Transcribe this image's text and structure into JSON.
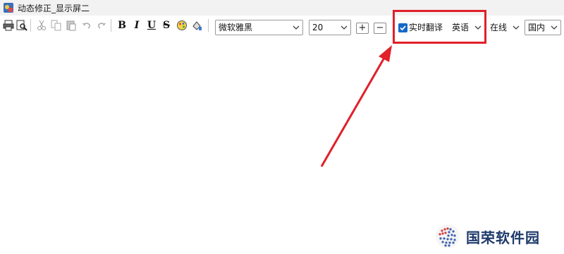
{
  "window": {
    "title": "动态修正_显示屏二"
  },
  "toolbar": {
    "icons": [
      {
        "name": "print-icon"
      },
      {
        "name": "print-preview-icon"
      },
      {
        "name": "cut-icon"
      },
      {
        "name": "copy-icon"
      },
      {
        "name": "paste-icon"
      },
      {
        "name": "undo-icon"
      },
      {
        "name": "redo-icon"
      },
      {
        "name": "bold-icon",
        "label": "B"
      },
      {
        "name": "italic-icon",
        "label": "I"
      },
      {
        "name": "underline-icon",
        "label": "U"
      },
      {
        "name": "strikethrough-icon",
        "label": "S"
      },
      {
        "name": "color-icon"
      },
      {
        "name": "fill-color-icon"
      }
    ],
    "font_family": "微软雅黑",
    "font_size": "20",
    "increase_label": "+",
    "decrease_label": "−",
    "realtime_translate": {
      "checked": true,
      "label": "实时翻译"
    },
    "language": "英语",
    "mode": "在线",
    "region": "国内"
  },
  "annotation": {
    "highlight_color": "#e0202a",
    "arrow_color": "#e0202a"
  },
  "watermark": {
    "text": "国荣软件园"
  },
  "colors": {
    "accent": "#1469c8",
    "title_bg": "#f2f2f2"
  }
}
